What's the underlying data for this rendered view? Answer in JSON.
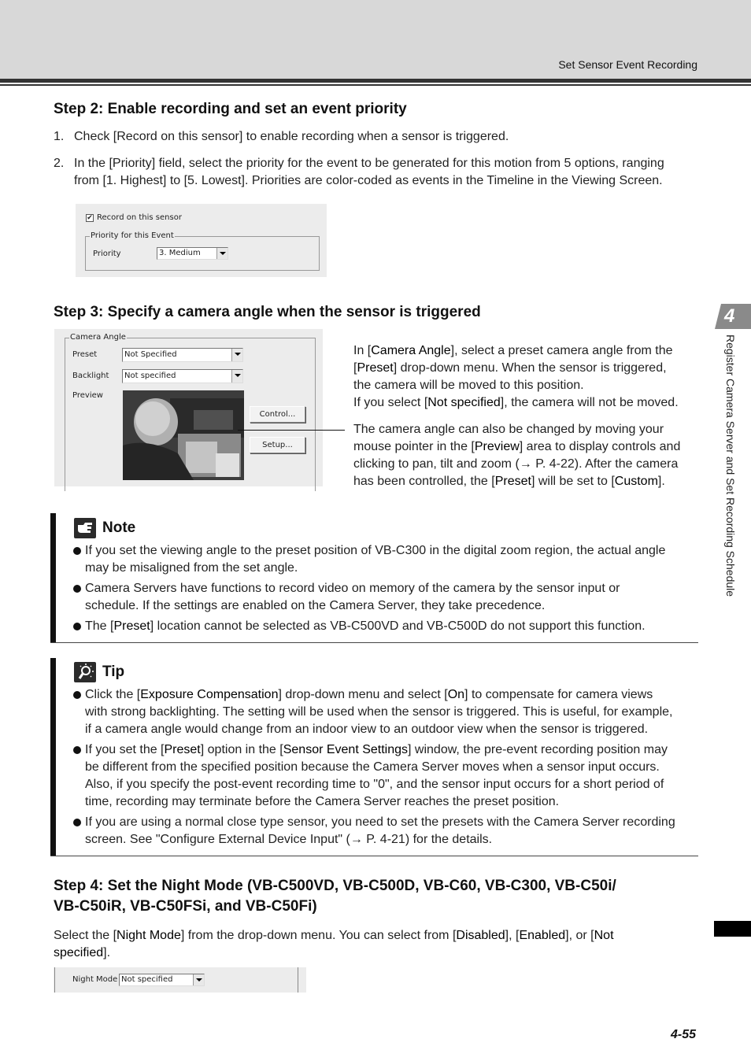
{
  "header": {
    "title": "Set Sensor Event Recording"
  },
  "side_tab": {
    "chapter": "4",
    "text": "Register Camera Server and Set Recording Schedule"
  },
  "step2": {
    "title": "Step 2: Enable recording and set an event priority",
    "items": [
      {
        "num": "1.",
        "text": "Check [Record on this sensor] to enable recording when a sensor is triggered."
      },
      {
        "num": "2.",
        "line1": "In the [Priority] field, select the priority for the event to be generated for this motion from 5 options, ranging",
        "line2": "from [1. Highest] to [5. Lowest]. Priorities are color-coded as events in the Timeline in the Viewing Screen."
      }
    ],
    "dialog": {
      "checkbox_label": "Record on this sensor",
      "checkbox_checked": true,
      "group_label": "Priority for this Event",
      "priority_label": "Priority",
      "priority_value": "3. Medium"
    }
  },
  "step3": {
    "title": "Step 3: Specify a camera angle when the sensor is triggered",
    "dialog": {
      "group_label": "Camera Angle",
      "preset_label": "Preset",
      "preset_value": "Not Specified",
      "backlight_label": "Backlight",
      "backlight_value": "Not specified",
      "preview_label": "Preview",
      "control_button": "Control...",
      "setup_button": "Setup..."
    },
    "para1": {
      "l1a": "In [",
      "l1b": "Camera Angle",
      "l1c": "], select a preset camera angle from the",
      "l2a": "[",
      "l2b": "Preset",
      "l2c": "] drop-down menu. When the sensor is triggered,",
      "l3": "the camera will be moved to this position.",
      "l4a": "If you select [",
      "l4b": "Not specified",
      "l4c": "], the camera will not be moved."
    },
    "para2": {
      "l1": "The camera angle can also be changed by moving your",
      "l2a": "mouse pointer in the [",
      "l2b": "Preview",
      "l2c": "] area to display controls and",
      "l3": "clicking to pan, tilt and zoom (→ P. 4-22). After the camera",
      "l4a": "has been controlled, the [",
      "l4b": "Preset",
      "l4c": "] will be set to [",
      "l4d": "Custom",
      "l4e": "]."
    }
  },
  "note": {
    "title": "Note",
    "items": [
      {
        "l1": "If you set the viewing angle to the preset position of VB-C300 in the digital zoom region, the actual angle",
        "l2": "may be misaligned from the set angle."
      },
      {
        "l1": "Camera Servers have functions to record video on memory of the camera by the sensor input or",
        "l2": "schedule. If the settings are enabled on the Camera Server, they take precedence."
      },
      {
        "a": "The [",
        "b": "Preset",
        "c": "] location cannot be selected as VB-C500VD and VB-C500D do not support this function."
      }
    ]
  },
  "tip": {
    "title": "Tip",
    "items": [
      {
        "a": "Click the [",
        "b": "Exposure Compensation",
        "c": "] drop-down menu and select [",
        "d": "On",
        "e": "] to compensate for camera views",
        "l2": "with strong backlighting. The setting will be used when the sensor is triggered. This is useful, for example,",
        "l3": "if a camera angle would change from an indoor view to an outdoor view when the sensor is triggered."
      },
      {
        "a": "If you set the [",
        "b": "Preset",
        "c": "] option in the [",
        "d": "Sensor Event Settings",
        "e": "] window, the pre-event recording position may",
        "l2": "be different from the specified position because the Camera Server moves when a sensor input occurs.",
        "l3": "Also, if you specify the post-event recording time to \"0\", and the sensor input occurs for a short period of",
        "l4": "time, recording may terminate before the Camera Server reaches the preset position."
      },
      {
        "l1": "If you are using a normal close type sensor, you need to set the presets with the Camera Server recording",
        "l2": "screen. See \"Configure External Device Input\" (→ P. 4-21) for the details."
      }
    ]
  },
  "step4": {
    "title_l1": "Step 4: Set the Night Mode (VB-C500VD, VB-C500D, VB-C60, VB-C300, VB-C50i/",
    "title_l2": "VB-C50iR, VB-C50FSi,  and VB-C50Fi)",
    "para": {
      "a": "Select the [",
      "b": "Night Mode",
      "c": "] from the drop-down menu. You can select from [",
      "d": "Disabled",
      "e": "], [",
      "f": "Enabled",
      "g": "], or [",
      "h": "Not",
      "l2a": "specified",
      "l2b": "]."
    },
    "dialog": {
      "night_mode_label": "Night Mode",
      "night_mode_value": "Not specified"
    }
  },
  "footer": {
    "page_number": "4-55"
  }
}
